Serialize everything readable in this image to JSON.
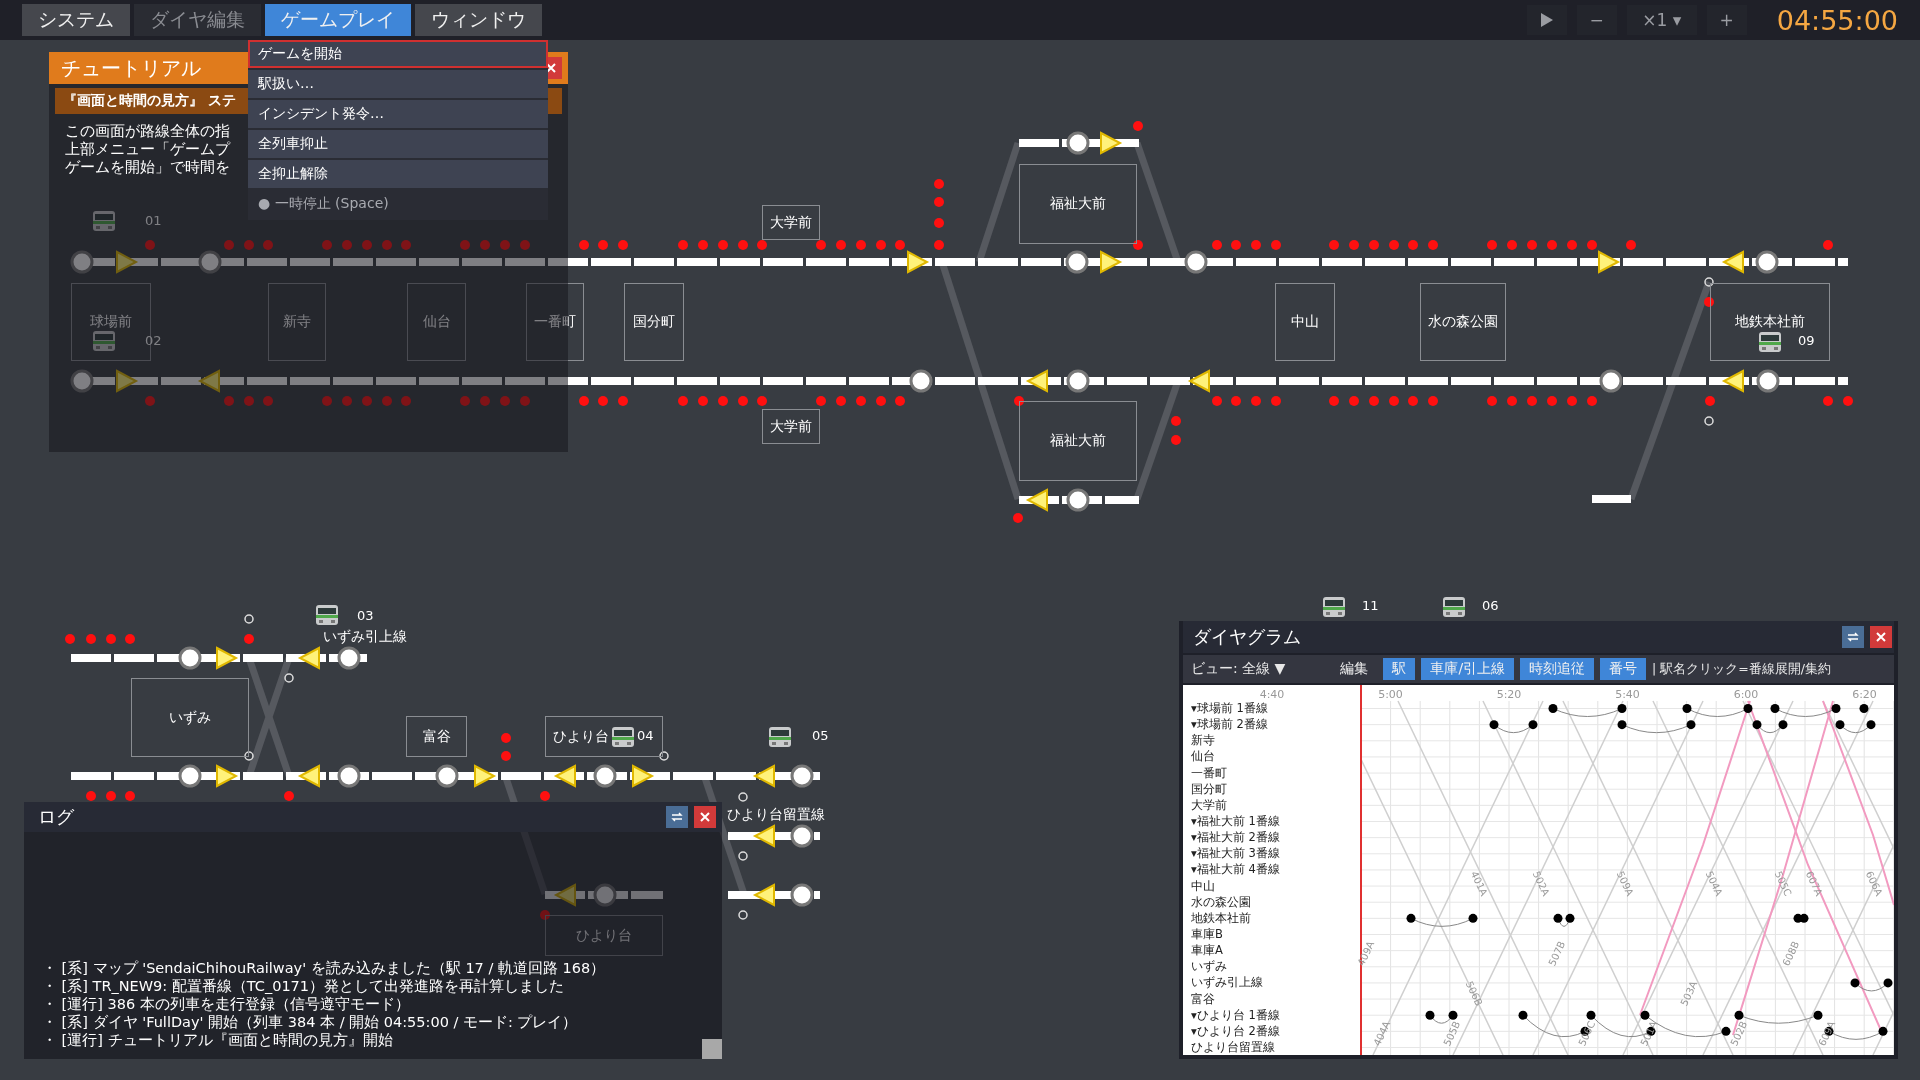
{
  "menu": [
    {
      "label": "システム",
      "selected": false,
      "disabled": false
    },
    {
      "label": "ダイヤ編集",
      "selected": false,
      "disabled": true
    },
    {
      "label": "ゲームプレイ",
      "selected": true,
      "disabled": false
    },
    {
      "label": "ウィンドウ",
      "selected": false,
      "disabled": false
    }
  ],
  "dropdown": [
    {
      "label": "ゲームを開始",
      "selected": true,
      "disabled": false
    },
    {
      "label": "駅扱い…",
      "selected": false,
      "disabled": false
    },
    {
      "label": "インシデント発令…",
      "selected": false,
      "disabled": false
    },
    {
      "label": "全列車抑止",
      "selected": false,
      "disabled": false
    },
    {
      "label": "全抑止解除",
      "selected": false,
      "disabled": false
    },
    {
      "label": "● 一時停止 (Space)",
      "selected": false,
      "disabled": true
    }
  ],
  "playback": {
    "minus": "−",
    "speed": "×1 ▾",
    "plus": "+",
    "clock": "04:55:00"
  },
  "tutorial": {
    "title": "チュートリアル",
    "step": "『画面と時間の見方』 ステ",
    "lines": [
      "この画面が路線全体の指",
      "上部メニュー「ゲームプ",
      "ゲームを開始」で時間を"
    ]
  },
  "map": {
    "stations": [
      "球場前",
      "新寺",
      "仙台",
      "一番町",
      "国分町",
      "大学前",
      "大学前",
      "福祉大前",
      "福祉大前",
      "中山",
      "水の森公園",
      "地鉄本社前",
      "いずみ",
      "富谷",
      "ひより台",
      "ひより台"
    ],
    "track_labels": [
      "いずみ引上線",
      "ひより台留置線"
    ],
    "trains": [
      "01",
      "02",
      "03",
      "04",
      "05",
      "09",
      "11",
      "06"
    ]
  },
  "log": {
    "title": "ログ",
    "entries": [
      "・ [系] マップ 'SendaiChihouRailway' を読み込みました（駅 17 / 軌道回路 168）",
      "・ [系] TR_NEW9: 配置番線（TC_0171）発として出発進路を再計算しました",
      "・ [運行] 386 本の列車を走行登録（信号遵守モード）",
      "・ [系] ダイヤ 'FullDay' 開始（列車 384 本 / 開始 04:55:00 / モード: プレイ）",
      "・ [運行] チュートリアル『画面と時間の見方』開始"
    ]
  },
  "diagram": {
    "title": "ダイヤグラム",
    "view": "ビュー: 全線 ▼",
    "toggles": [
      {
        "label": "編集",
        "on": false
      },
      {
        "label": "駅",
        "on": true
      },
      {
        "label": "車庫/引上線",
        "on": true
      },
      {
        "label": "時刻追従",
        "on": true
      },
      {
        "label": "番号",
        "on": true
      }
    ],
    "hint": "| 駅名クリック=番線展開/集約",
    "time_ticks": [
      "4:40",
      "5:00",
      "5:20",
      "5:40",
      "6:00",
      "6:20"
    ],
    "stations": [
      "▾球場前 1番線",
      "▾球場前 2番線",
      "新寺",
      "仙台",
      "一番町",
      "国分町",
      "大学前",
      "▾福祉大前 1番線",
      "▾福祉大前 2番線",
      "▾福祉大前 3番線",
      "▾福祉大前 4番線",
      "中山",
      "水の森公園",
      "地鉄本社前",
      "車庫B",
      "車庫A",
      "いずみ",
      "いずみ引上線",
      "富谷",
      "▾ひより台 1番線",
      "▾ひより台 2番線",
      "ひより台留置線"
    ],
    "train_labels": [
      "409A",
      "401A",
      "502A",
      "509A",
      "504A",
      "505C",
      "607A",
      "606A",
      "507B",
      "608B",
      "506B",
      "503A",
      "404A",
      "505B",
      "506C",
      "501A",
      "502B",
      "609A"
    ]
  }
}
